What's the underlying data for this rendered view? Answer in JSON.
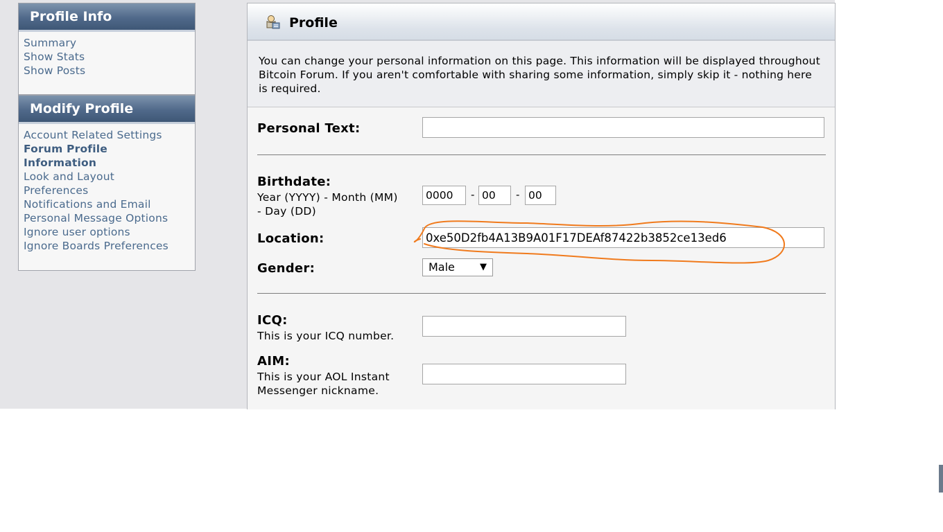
{
  "sidebar": {
    "profile_info": {
      "title": "Profile Info",
      "items": [
        "Summary",
        "Show Stats",
        "Show Posts"
      ]
    },
    "modify_profile": {
      "title": "Modify Profile",
      "items": [
        "Account Related Settings",
        "Forum Profile",
        "Information",
        "Look and Layout",
        "Preferences",
        "Notifications and Email",
        "Personal Message Options",
        "Ignore user options",
        "Ignore Boards Preferences"
      ]
    }
  },
  "main": {
    "title": "Profile",
    "intro": "You can change your personal information on this page. This information will be displayed throughout Bitcoin Forum. If you aren't comfortable with sharing some information, simply skip it - nothing here is required.",
    "personal_text": {
      "label": "Personal Text:",
      "value": ""
    },
    "birthdate": {
      "label": "Birthdate:",
      "hint_line1": "Year (YYYY) - Month (MM)",
      "hint_line2": "- Day (DD)",
      "year": "0000",
      "month": "00",
      "day": "00",
      "separator": "-"
    },
    "location": {
      "label": "Location:",
      "value": "0xe50D2fb4A13B9A01F17DEAf87422b3852ce13ed6"
    },
    "gender": {
      "label": "Gender:",
      "value": "Male"
    },
    "icq": {
      "label": "ICQ:",
      "hint": "This is your ICQ number.",
      "value": ""
    },
    "aim": {
      "label": "AIM:",
      "hint_line1": "This is your AOL Instant",
      "hint_line2": "Messenger nickname.",
      "value": ""
    }
  },
  "colors": {
    "header_blue": "#50698a",
    "link_blue": "#4a6a8d",
    "annotation_orange": "#f07a1c"
  }
}
